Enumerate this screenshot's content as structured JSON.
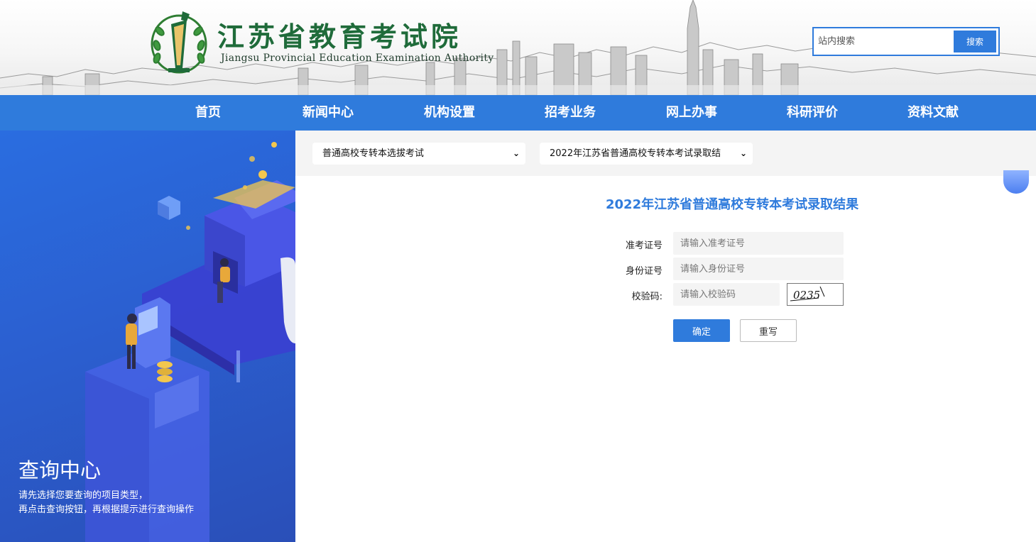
{
  "header": {
    "title_cn": "江苏省教育考试院",
    "title_en": "Jiangsu Provincial Education Examination Authority",
    "search": {
      "placeholder": "站内搜索",
      "button_label": "搜索"
    }
  },
  "nav": {
    "items": [
      "首页",
      "新闻中心",
      "机构设置",
      "招考业务",
      "网上办事",
      "科研评价",
      "资料文献"
    ]
  },
  "left_panel": {
    "title": "查询中心",
    "desc_line1": "请先选择您要查询的项目类型，",
    "desc_line2": "再点击查询按钮，再根据提示进行查询操作"
  },
  "selects": {
    "exam_type": "普通高校专转本选拔考试",
    "query_item": "2022年江苏省普通高校专转本考试录取结"
  },
  "form": {
    "title": "2022年江苏省普通高校专转本考试录取结果",
    "ticket_label": "准考证号",
    "ticket_placeholder": "请输入准考证号",
    "id_label": "身份证号",
    "id_placeholder": "请输入身份证号",
    "captcha_label": "校验码:",
    "captcha_placeholder": "请输入校验码",
    "captcha_text": "0235",
    "confirm_label": "确定",
    "reset_label": "重写"
  },
  "colors": {
    "brand_blue": "#2f7bdc",
    "logo_green": "#1f6b3a"
  }
}
